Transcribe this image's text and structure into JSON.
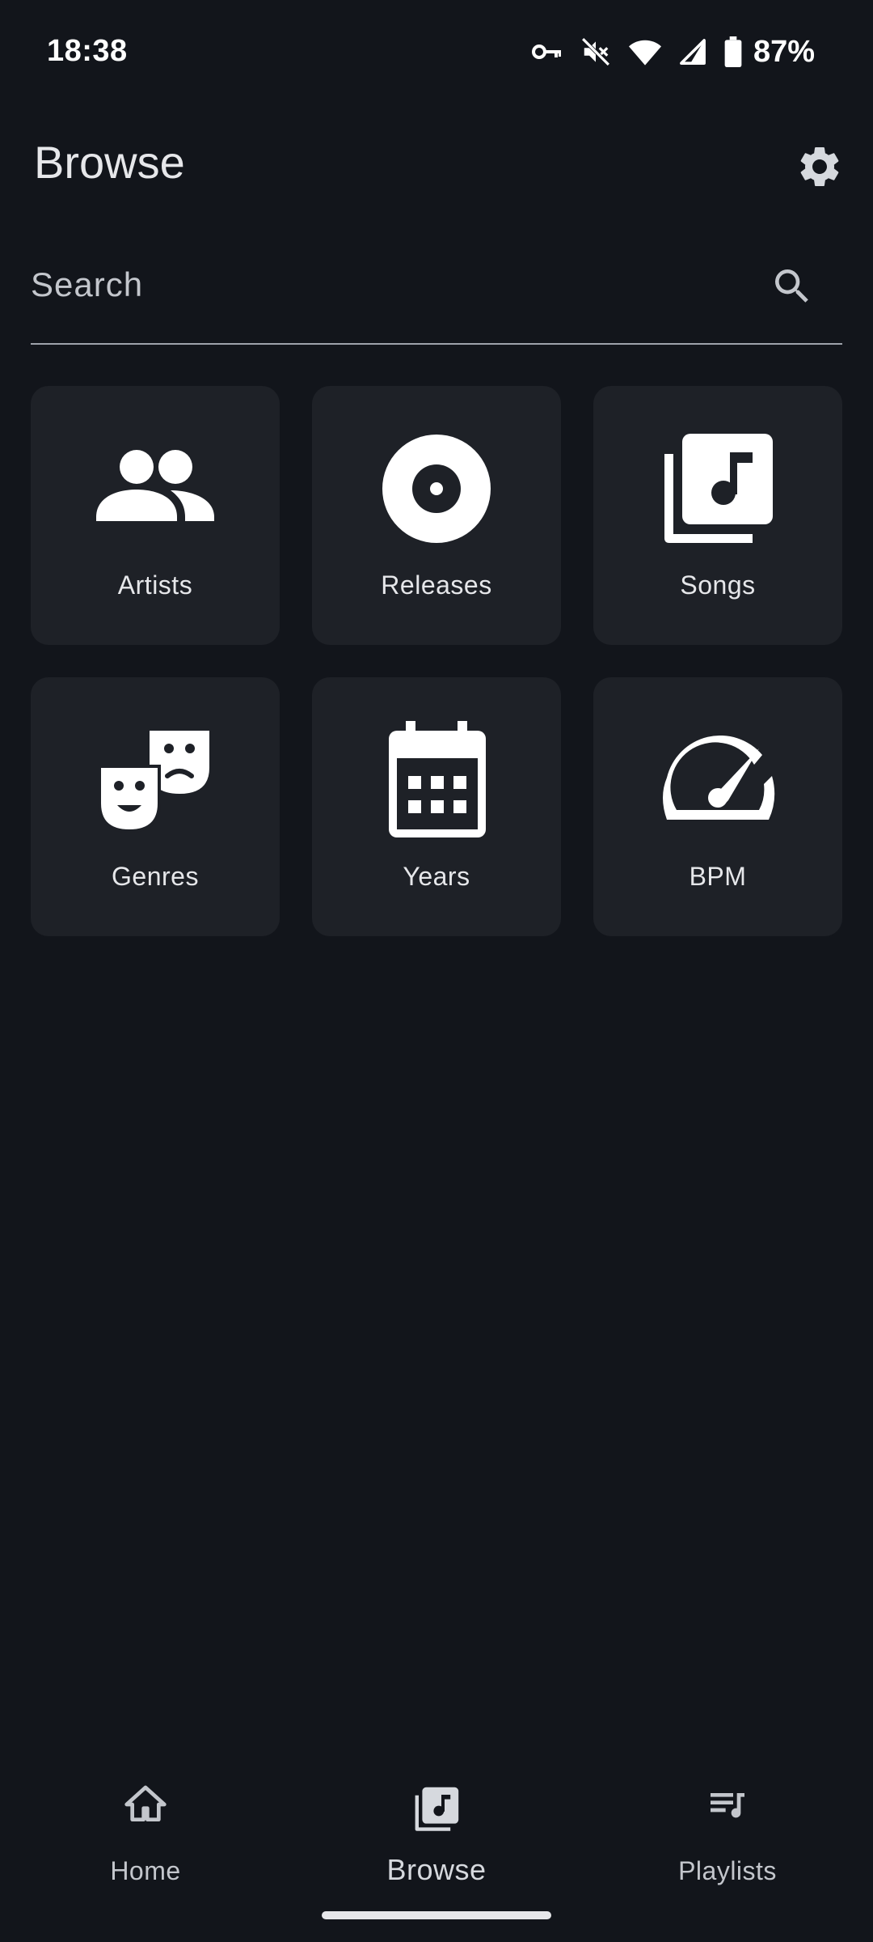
{
  "status_bar": {
    "time": "18:38",
    "battery_percent": "87%",
    "icons": [
      "vpn-key-icon",
      "mute-icon",
      "wifi-icon",
      "signal-icon",
      "battery-icon"
    ]
  },
  "header": {
    "title": "Browse",
    "settings_icon": "gear-icon"
  },
  "search": {
    "placeholder": "Search",
    "value": "",
    "icon": "search-icon"
  },
  "categories": [
    {
      "label": "Artists",
      "icon": "people-icon"
    },
    {
      "label": "Releases",
      "icon": "disc-icon"
    },
    {
      "label": "Songs",
      "icon": "music-library-icon"
    },
    {
      "label": "Genres",
      "icon": "theater-masks-icon"
    },
    {
      "label": "Years",
      "icon": "calendar-icon"
    },
    {
      "label": "BPM",
      "icon": "speedometer-icon"
    }
  ],
  "bottom_nav": {
    "items": [
      {
        "label": "Home",
        "icon": "home-icon",
        "selected": false
      },
      {
        "label": "Browse",
        "icon": "music-library-icon",
        "selected": true
      },
      {
        "label": "Playlists",
        "icon": "playlist-icon",
        "selected": false
      }
    ]
  },
  "colors": {
    "background": "#12151b",
    "tile": "#1e2127",
    "text": "#e6e7ea",
    "muted_text": "#c3c6cc",
    "divider": "#9ea3ab"
  }
}
